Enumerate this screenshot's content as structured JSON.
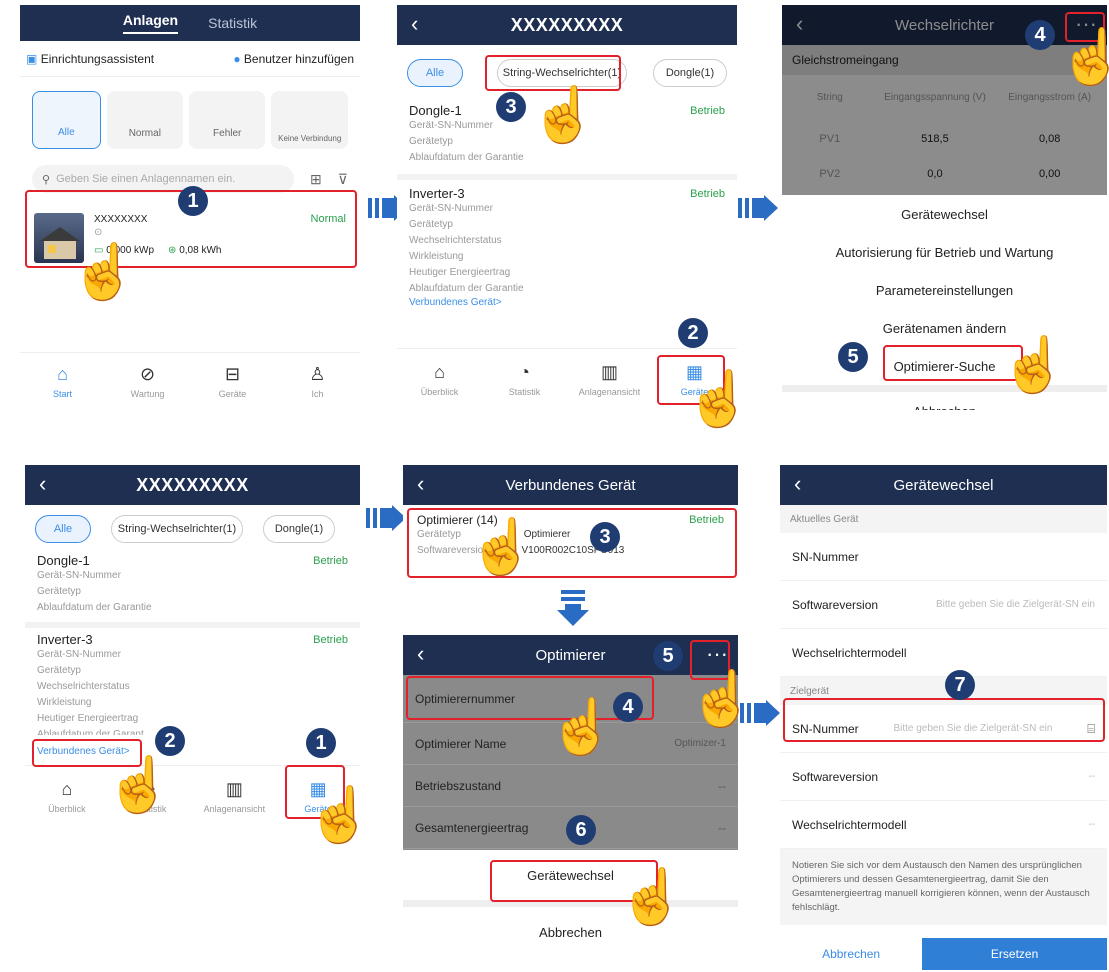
{
  "p1": {
    "tabs": [
      "Anlagen",
      "Statistik"
    ],
    "wizard": "Einrichtungsassistent",
    "add_user": "Benutzer hinzufügen",
    "filters": [
      "Alle",
      "Normal",
      "Fehler",
      "Keine Verbindung"
    ],
    "search_placeholder": "Geben Sie einen Anlagennamen ein.",
    "plant_name": "XXXXXXXX",
    "plant_status": "Normal",
    "plant_loc": "⊙",
    "capacity": "0,000 kWp",
    "energy": "0,08 kWh",
    "nav": [
      "Start",
      "Wartung",
      "Geräte",
      "Ich"
    ]
  },
  "p2": {
    "title": "XXXXXXXXX",
    "chips": [
      "Alle",
      "String-Wechselrichter(1)",
      "Dongle(1)"
    ],
    "dongle": {
      "name": "Dongle-1",
      "status": "Betrieb",
      "lines": [
        "Gerät-SN-Nummer",
        "Gerätetyp",
        "Ablaufdatum der Garantie"
      ]
    },
    "inverter": {
      "name": "Inverter-3",
      "status": "Betrieb",
      "lines": [
        "Gerät-SN-Nummer",
        "Gerätetyp",
        "Wechselrichterstatus",
        "Wirkleistung",
        "Heutiger Energieertrag",
        "Ablaufdatum der Garantie"
      ],
      "link": "Verbundenes Gerät>"
    },
    "nav": [
      "Überblick",
      "Statistik",
      "Anlagenansicht",
      "Geräte"
    ]
  },
  "p3": {
    "title": "Wechselrichter",
    "more": "···",
    "section": "Gleichstromeingang",
    "cols": [
      "String",
      "Eingangsspannung (V)",
      "Eingangsstrom (A)"
    ],
    "rows": [
      [
        "PV1",
        "518,5",
        "0,08"
      ],
      [
        "PV2",
        "0,0",
        "0,00"
      ]
    ],
    "options": [
      "Gerätewechsel",
      "Autorisierung für Betrieb und Wartung",
      "Parametereinstellungen",
      "Gerätenamen ändern",
      "Optimierer-Suche"
    ],
    "cancel": "Abbrechen"
  },
  "p4": {
    "title": "XXXXXXXXX",
    "chips": [
      "Alle",
      "String-Wechselrichter(1)",
      "Dongle(1)"
    ],
    "dongle": {
      "name": "Dongle-1",
      "status": "Betrieb",
      "lines": [
        "Gerät-SN-Nummer",
        "Gerätetyp",
        "Ablaufdatum der Garantie"
      ]
    },
    "inverter": {
      "name": "Inverter-3",
      "status": "Betrieb",
      "lines": [
        "Gerät-SN-Nummer",
        "Gerätetyp",
        "Wechselrichterstatus",
        "Wirkleistung",
        "Heutiger Energieertrag",
        "Ablaufdatum der Garant"
      ],
      "link": "Verbundenes Gerät>"
    },
    "nav": [
      "Überblick",
      "Statistik",
      "Anlagenansicht",
      "Geräte"
    ]
  },
  "p5": {
    "title": "Verbundenes Gerät",
    "opt_name": "Optimierer (14)",
    "opt_status": "Betrieb",
    "type_label": "Gerätetyp",
    "type_val": "Optimierer",
    "sw_label": "Softwareversion",
    "sw_val": "V100R002C10SPC013"
  },
  "p6": {
    "title": "Optimierer",
    "more": "···",
    "rows": [
      [
        "Optimierernummer",
        ""
      ],
      [
        "Optimierer Name",
        "Optimizer-1"
      ],
      [
        "Betriebszustand",
        "--"
      ],
      [
        "Gesamtenergieertrag",
        "--"
      ]
    ],
    "option": "Gerätewechsel",
    "cancel": "Abbrechen"
  },
  "p7": {
    "title": "Gerätewechsel",
    "current": "Aktuelles Gerät",
    "target": "Zielgerät",
    "cur_fields": [
      [
        "SN-Nummer",
        ""
      ],
      [
        "Softwareversion",
        "Bitte geben Sie die Zielgerät-SN ein"
      ],
      [
        "Wechselrichtermodell",
        ""
      ]
    ],
    "tgt_fields": [
      [
        "SN-Nummer",
        "Bitte geben Sie die Zielgerät-SN ein"
      ],
      [
        "Softwareversion",
        "--"
      ],
      [
        "Wechselrichtermodell",
        "--"
      ]
    ],
    "note": "Notieren Sie sich vor dem Austausch den Namen des ursprünglichen Optimierers und dessen Gesamtenergieertrag, damit Sie den Gesamtenergieertrag manuell korrigieren können, wenn der Austausch fehlschlägt.",
    "cancel": "Abbrechen",
    "replace": "Ersetzen"
  },
  "steps": [
    "1",
    "2",
    "3",
    "4",
    "5",
    "6",
    "7"
  ]
}
